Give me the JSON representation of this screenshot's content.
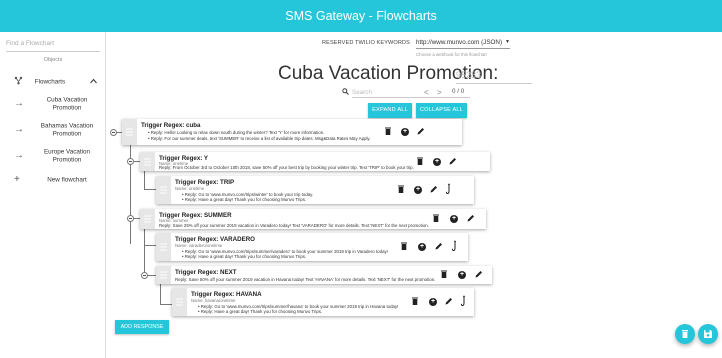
{
  "app": {
    "title": "SMS Gateway - Flowcharts",
    "accent_color": "#26c6da"
  },
  "sidebar": {
    "find_placeholder": "Find a Flowchart",
    "section_label": "Objects",
    "group": {
      "label": "Flowcharts",
      "icon": "tree-icon",
      "chevron": "^"
    },
    "items": [
      {
        "label": "Cuba Vacation Promotion",
        "icon": "arrow-right-icon"
      },
      {
        "label": "Bahamas Vacation Promotion",
        "icon": "arrow-right-icon"
      },
      {
        "label": "Europe Vacation Promotion",
        "icon": "arrow-right-icon"
      },
      {
        "label": "New flowchart",
        "icon": "plus-icon"
      }
    ]
  },
  "keywords": {
    "label": "RESERVED TWILIO KEYWORDS",
    "selected": "http://www.munvo.com (JSON)",
    "hint": "Choose a webhook for this flowchart"
  },
  "flowchart": {
    "title": "Cuba Vacation Promotion:",
    "id": "95283"
  },
  "search": {
    "placeholder": "Search",
    "prev": "<",
    "next": ">",
    "count": "0 / 0"
  },
  "buttons": {
    "expand_all": "EXPAND ALL",
    "collapse_all": "COLLAPSE ALL",
    "add_response": "ADD RESPONSE"
  },
  "nodes": {
    "cuba": {
      "title": "Trigger Regex: cuba",
      "bullets": [
        "Reply: Hello! Looking to relax down south during the winter? Text 'Y' for more information.",
        "Reply: For our summer deals, text 'SUMMER' to receive a list of available trip dates. Msg&Data Rates May Apply."
      ]
    },
    "y": {
      "title": "Trigger Regex: Y",
      "name": "Name: onetime",
      "reply": "Reply: From October 3rd to October 10th 2018, save 50% off your best trip by booking your winter trip. Text 'TRIP' to book your trip."
    },
    "trip": {
      "title": "Trigger Regex: TRIP",
      "name": "Name: onetime",
      "bullets": [
        "Reply: Go to 'www.munvo.com/trips/winter' to book your trip today.",
        "Reply: Have a great day! Thank you for choosing Munvo Trips."
      ]
    },
    "summer": {
      "title": "Trigger Regex: SUMMER",
      "name": "Name: summer",
      "reply": "Reply: Save 25% off your summer 2019 vacation in Varadero today! Text 'VARADERO' for more details. Text 'NEXT' for the next promotion."
    },
    "varadero": {
      "title": "Trigger Regex: VARADERO",
      "name": "Name: varadero/onetime",
      "bullets": [
        "Reply: Go to 'www.munvo.com/trips/summer/varadero' to book your summer 2019 trip in Varadero today!",
        "Reply: Have a great day! Thank you for choosing Munvo Trips."
      ]
    },
    "next": {
      "title": "Trigger Regex: NEXT",
      "reply": "Reply: Save 50% off your summer 2019 vacation in Havana today! Text 'HAVANA' for more details. Text 'NEXT' for the next promotion."
    },
    "havana": {
      "title": "Trigger Regex: HAVANA",
      "name": "Name: havana/onetime",
      "bullets": [
        "Reply: Go to 'www.munvo.com/trips/summer/havana' to book your summer 2019 trip in Havana today!",
        "Reply: Have a great day! Thank you for choosing Munvo Trips."
      ]
    }
  },
  "icons": {
    "delete": "trash-icon",
    "add": "add-circle-icon",
    "edit": "pencil-icon",
    "link": "hook-icon",
    "save": "floppy-icon"
  }
}
